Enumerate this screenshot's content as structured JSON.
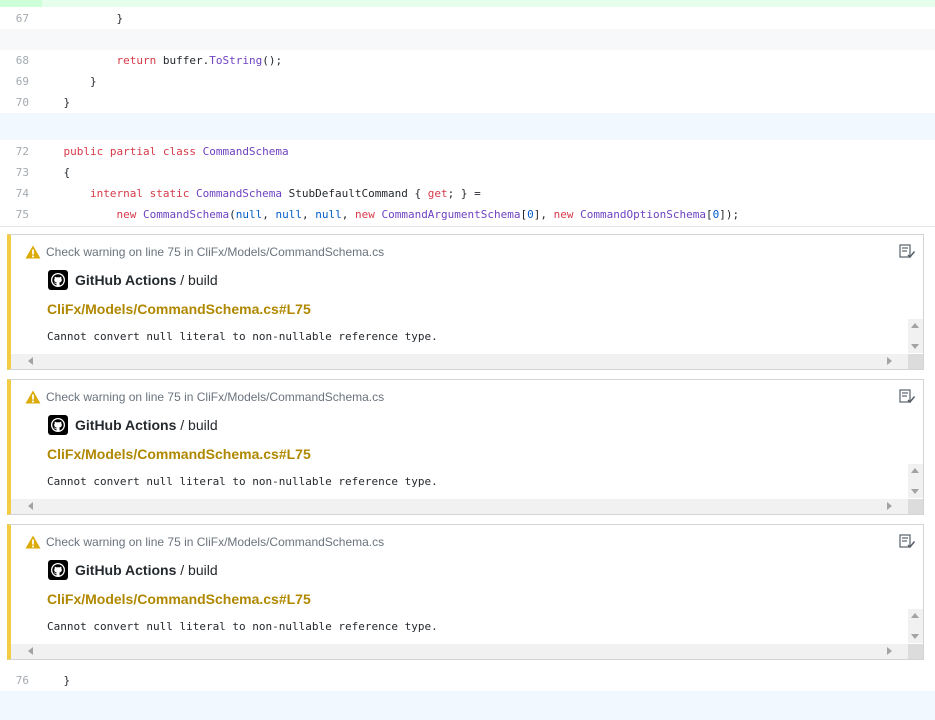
{
  "diff": {
    "lines_before": [
      {
        "num": "67",
        "tokens": [
          {
            "t": "}",
            "c": ""
          }
        ],
        "indent": "            "
      },
      {
        "num": "68",
        "tokens": [
          {
            "t": "return",
            "c": "k"
          },
          {
            "t": " buffer.",
            "c": ""
          },
          {
            "t": "ToString",
            "c": "t"
          },
          {
            "t": "();",
            "c": ""
          }
        ],
        "indent": "            "
      },
      {
        "num": "69",
        "tokens": [
          {
            "t": "}",
            "c": ""
          }
        ],
        "indent": "        "
      },
      {
        "num": "70",
        "tokens": [
          {
            "t": "}",
            "c": ""
          }
        ],
        "indent": "    "
      },
      {
        "num": "72",
        "tokens": [
          {
            "t": "public partial class",
            "c": "k"
          },
          {
            "t": " ",
            "c": ""
          },
          {
            "t": "CommandSchema",
            "c": "t"
          }
        ],
        "indent": "    "
      },
      {
        "num": "73",
        "tokens": [
          {
            "t": "{",
            "c": ""
          }
        ],
        "indent": "    "
      },
      {
        "num": "74",
        "tokens": [
          {
            "t": "internal static",
            "c": "k"
          },
          {
            "t": " ",
            "c": ""
          },
          {
            "t": "CommandSchema",
            "c": "t"
          },
          {
            "t": " StubDefaultCommand { ",
            "c": ""
          },
          {
            "t": "get",
            "c": "k"
          },
          {
            "t": "; } =",
            "c": ""
          }
        ],
        "indent": "        "
      },
      {
        "num": "75",
        "tokens": [
          {
            "t": "new",
            "c": "k"
          },
          {
            "t": " ",
            "c": ""
          },
          {
            "t": "CommandSchema",
            "c": "t"
          },
          {
            "t": "(",
            "c": ""
          },
          {
            "t": "null",
            "c": "c"
          },
          {
            "t": ", ",
            "c": ""
          },
          {
            "t": "null",
            "c": "c"
          },
          {
            "t": ", ",
            "c": ""
          },
          {
            "t": "null",
            "c": "c"
          },
          {
            "t": ", ",
            "c": ""
          },
          {
            "t": "new",
            "c": "k"
          },
          {
            "t": " ",
            "c": ""
          },
          {
            "t": "CommandArgumentSchema",
            "c": "t"
          },
          {
            "t": "[",
            "c": ""
          },
          {
            "t": "0",
            "c": "c"
          },
          {
            "t": "], ",
            "c": ""
          },
          {
            "t": "new",
            "c": "k"
          },
          {
            "t": " ",
            "c": ""
          },
          {
            "t": "CommandOptionSchema",
            "c": "t"
          },
          {
            "t": "[",
            "c": ""
          },
          {
            "t": "0",
            "c": "c"
          },
          {
            "t": "]);",
            "c": ""
          }
        ],
        "indent": "            "
      }
    ],
    "line_after": {
      "num": "76",
      "tokens": [
        {
          "t": "}",
          "c": ""
        }
      ],
      "indent": "    "
    }
  },
  "annotations": [
    {
      "title": "Check warning on line 75 in CliFx/Models/CommandSchema.cs",
      "app": "GitHub Actions",
      "job": "build",
      "path": "CliFx/Models/CommandSchema.cs#L75",
      "message": "Cannot convert null literal to non-nullable reference type."
    },
    {
      "title": "Check warning on line 75 in CliFx/Models/CommandSchema.cs",
      "app": "GitHub Actions",
      "job": "build",
      "path": "CliFx/Models/CommandSchema.cs#L75",
      "message": "Cannot convert null literal to non-nullable reference type."
    },
    {
      "title": "Check warning on line 75 in CliFx/Models/CommandSchema.cs",
      "app": "GitHub Actions",
      "job": "build",
      "path": "CliFx/Models/CommandSchema.cs#L75",
      "message": "Cannot convert null literal to non-nullable reference type."
    }
  ],
  "colors": {
    "keyword": "#d73a49",
    "type": "#6f42c1",
    "constant": "#005cc5",
    "warning_accent": "#f2cd44",
    "path_link": "#b08800",
    "hunk_bg": "#f1f8ff"
  },
  "icons": [
    "warning-icon",
    "edit-annotation-icon",
    "github-icon"
  ]
}
